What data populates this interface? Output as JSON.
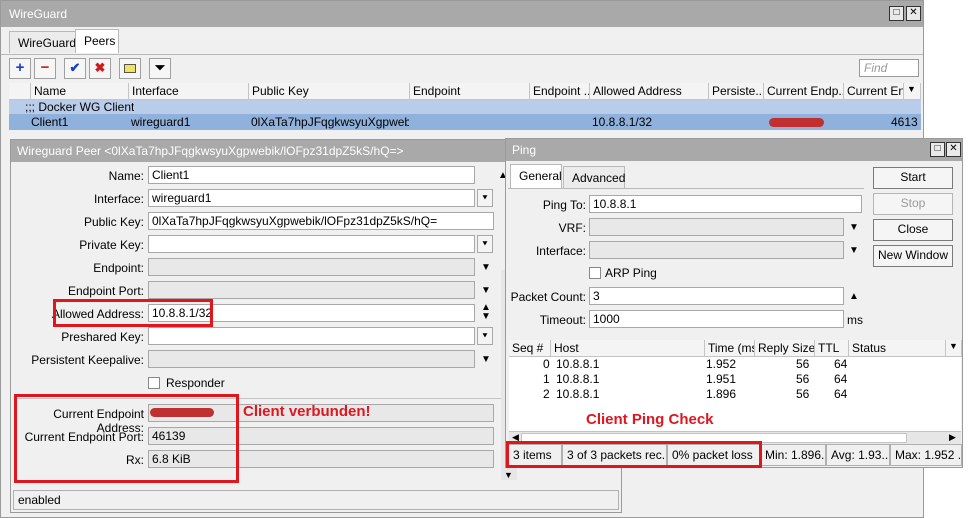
{
  "wg": {
    "title": "WireGuard",
    "tabs": [
      "WireGuard",
      "Peers"
    ],
    "find_placeholder": "Find",
    "columns": [
      "Name",
      "Interface",
      "Public Key",
      "Endpoint",
      "Endpoint ...",
      "Allowed Address",
      "Persiste...",
      "Current Endp...",
      "Current Endp"
    ],
    "group_label": ";;; Docker WG Client",
    "row": {
      "name": "Client1",
      "interface": "wireguard1",
      "public_key": "0lXaTa7hpJFqgkwsyuXgpwebi...",
      "allowed_address": "10.8.8.1/32",
      "current_endpoint_port": "4613"
    }
  },
  "peer": {
    "title": "Wireguard Peer <0lXaTa7hpJFqgkwsyuXgpwebik/lOFpz31dpZ5kS/hQ=>",
    "fields": {
      "name_label": "Name:",
      "name": "Client1",
      "interface_label": "Interface:",
      "interface": "wireguard1",
      "public_key_label": "Public Key:",
      "public_key": "0lXaTa7hpJFqgkwsyuXgpwebik/lOFpz31dpZ5kS/hQ=",
      "private_key_label": "Private Key:",
      "endpoint_label": "Endpoint:",
      "endpoint_port_label": "Endpoint Port:",
      "allowed_address_label": "Allowed Address:",
      "allowed_address": "10.8.8.1/32",
      "preshared_key_label": "Preshared Key:",
      "persistent_keepalive_label": "Persistent Keepalive:",
      "responder_label": "Responder",
      "current_endpoint_address_label": "Current Endpoint Address:",
      "current_endpoint_port_label": "Current Endpoint Port:",
      "current_endpoint_port": "46139",
      "rx_label": "Rx:",
      "rx": "6.8 KiB"
    },
    "annotation": "Client verbunden!",
    "status": "enabled"
  },
  "ping": {
    "title": "Ping",
    "tabs": [
      "General",
      "Advanced"
    ],
    "ping_to_label": "Ping To:",
    "ping_to": "10.8.8.1",
    "vrf_label": "VRF:",
    "interface_label": "Interface:",
    "arp_ping_label": "ARP Ping",
    "packet_count_label": "Packet Count:",
    "packet_count": "3",
    "timeout_label": "Timeout:",
    "timeout": "1000",
    "timeout_unit": "ms",
    "buttons": {
      "start": "Start",
      "stop": "Stop",
      "close": "Close",
      "new_window": "New Window"
    },
    "columns": [
      "Seq #",
      "Host",
      "Time (ms)",
      "Reply Size",
      "TTL",
      "Status"
    ],
    "rows": [
      {
        "seq": "0",
        "host": "10.8.8.1",
        "time": "1.952",
        "size": "56",
        "ttl": "64"
      },
      {
        "seq": "1",
        "host": "10.8.8.1",
        "time": "1.951",
        "size": "56",
        "ttl": "64"
      },
      {
        "seq": "2",
        "host": "10.8.8.1",
        "time": "1.896",
        "size": "56",
        "ttl": "64"
      }
    ],
    "annotation": "Client Ping Check",
    "status": {
      "items": "3 items",
      "received": "3 of 3 packets rec...",
      "loss": "0% packet loss",
      "min": "Min: 1.896...",
      "avg": "Avg: 1.93...",
      "max": "Max: 1.952 ..."
    }
  }
}
